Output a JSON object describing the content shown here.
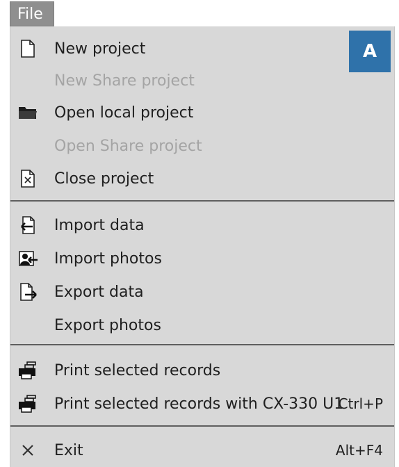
{
  "menu_bar": {
    "file_label": "File"
  },
  "badge": {
    "text": "A",
    "color": "#2f72aa"
  },
  "menu": {
    "items": [
      {
        "label": "New project",
        "icon": "document-icon",
        "enabled": true
      },
      {
        "label": "New Share project",
        "icon": "",
        "enabled": false
      },
      {
        "label": "Open local project",
        "icon": "folder-icon",
        "enabled": true
      },
      {
        "label": "Open Share project",
        "icon": "",
        "enabled": false
      },
      {
        "label": "Close project",
        "icon": "close-document-icon",
        "enabled": true
      },
      {
        "label": "Import data",
        "icon": "import-data-icon",
        "enabled": true
      },
      {
        "label": "Import photos",
        "icon": "import-photos-icon",
        "enabled": true
      },
      {
        "label": "Export data",
        "icon": "export-data-icon",
        "enabled": true
      },
      {
        "label": "Export photos",
        "icon": "",
        "enabled": true
      },
      {
        "label": "Print selected records",
        "icon": "printer-icon",
        "enabled": true
      },
      {
        "label": "Print selected records with CX-330 U1",
        "shortcut": "Ctrl+P",
        "icon": "printer-icon",
        "enabled": true
      },
      {
        "label": "Exit",
        "shortcut": "Alt+F4",
        "icon": "close-icon",
        "enabled": true
      }
    ]
  }
}
